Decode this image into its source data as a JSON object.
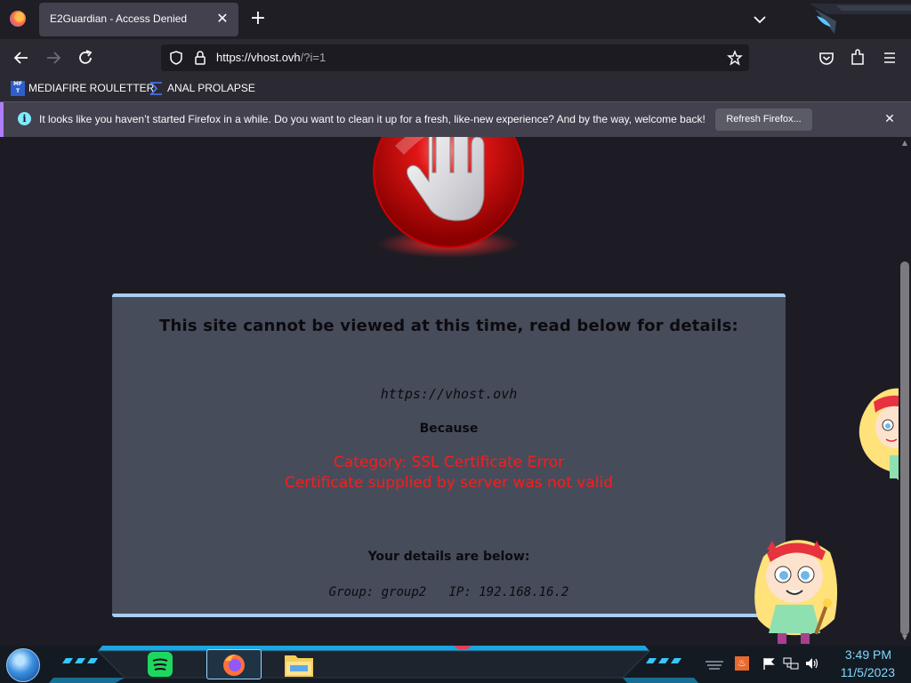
{
  "browser": {
    "tab_title": "E2Guardian - Access Denied",
    "url_host": "https://vhost.ovh",
    "url_path": "/?i=1"
  },
  "bookmarks": [
    {
      "label": "MEDIAFIRE ROULETTER",
      "icon": "mediafire-icon",
      "icon_text": "MF"
    },
    {
      "label": "ANAL PROLAPSE",
      "icon": "sigma-icon"
    }
  ],
  "notification": {
    "text": "It looks like you haven’t started Firefox in a while. Do you want to clean it up for a fresh, like-new experience? And by the way, welcome back!",
    "button_label": "Refresh Firefox..."
  },
  "block_page": {
    "heading": "This site cannot be viewed at this time, read below for details:",
    "blocked_url": "https://vhost.ovh",
    "because_label": "Because",
    "category": "Category: SSL Certificate Error",
    "reason": "Certificate supplied by server was not valid",
    "details_heading": "Your details are below:",
    "details": "Group: group2   IP: 192.168.16.2"
  },
  "taskbar": {
    "time": "3:49 PM",
    "date": "11/5/2023"
  },
  "colors": {
    "panel": "#474c5a",
    "panel_border": "#a9cdf3",
    "error_text": "#ff1a1a",
    "tray_text": "#7fd8ff"
  }
}
